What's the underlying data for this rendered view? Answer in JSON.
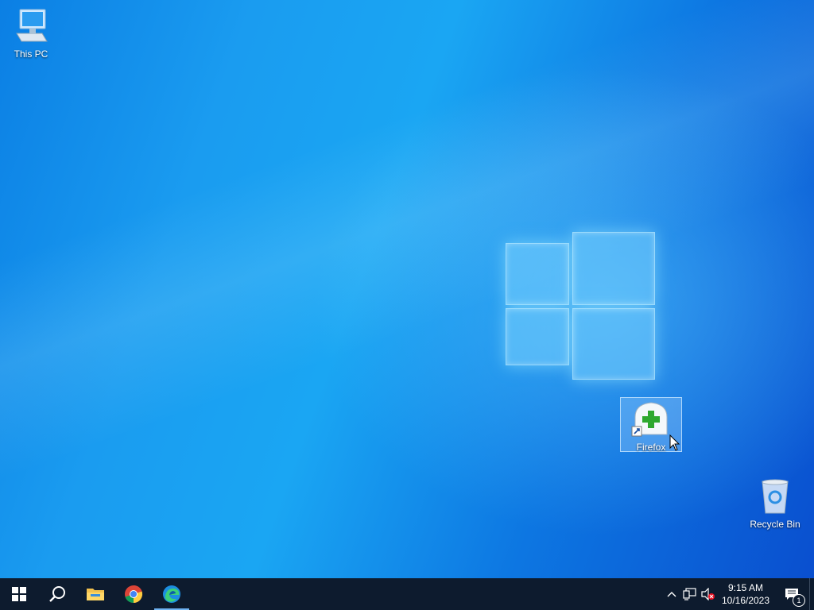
{
  "desktop": {
    "icons": [
      {
        "label": "This PC",
        "icon": "computer-icon"
      },
      {
        "label": "Firefox",
        "icon": "installer-shortcut-icon"
      },
      {
        "label": "Recycle Bin",
        "icon": "recycle-bin-icon"
      }
    ]
  },
  "taskbar": {
    "start": {
      "icon": "windows-start-icon"
    },
    "search": {
      "icon": "search-icon"
    },
    "pinned": [
      {
        "icon": "file-explorer-icon"
      },
      {
        "icon": "chrome-icon"
      },
      {
        "icon": "edge-icon",
        "active": true
      }
    ],
    "tray": {
      "time": "9:15 AM",
      "date": "10/16/2023",
      "notification_count": "1"
    }
  },
  "colors": {
    "taskbar": "#0d1b2e",
    "accent": "#6fb3f2"
  }
}
